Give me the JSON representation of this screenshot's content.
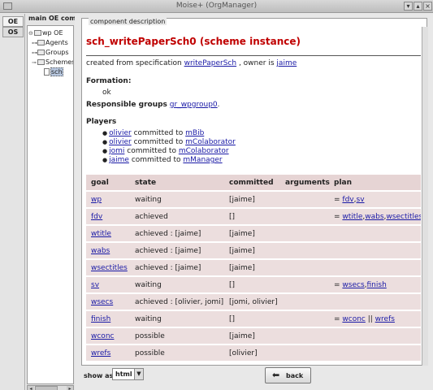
{
  "window": {
    "title": "Moise+ (OrgManager)"
  },
  "tabs": [
    {
      "label": "OE"
    },
    {
      "label": "OS"
    }
  ],
  "tree": {
    "header": "main OE com",
    "nodes": [
      {
        "label": "wp OE"
      },
      {
        "label": "Agents"
      },
      {
        "label": "Groups"
      },
      {
        "label": "Schemes"
      },
      {
        "label": "sch"
      }
    ]
  },
  "panel": {
    "legend": "component description"
  },
  "scheme": {
    "title": "sch_writePaperSch0 (scheme instance)",
    "created_prefix": "created from specification",
    "spec_link": "writePaperSch",
    "owner_text": ", owner is",
    "owner_link": "jaime"
  },
  "formation": {
    "label": "Formation:",
    "value": "ok"
  },
  "responsible": {
    "label": "Responsible groups",
    "link": "gr_wpgroup0",
    "trail": "."
  },
  "players": {
    "label": "Players",
    "items": [
      {
        "agent": "olivier",
        "text": "committed to",
        "mission": "mBib"
      },
      {
        "agent": "olivier",
        "text": "committed to",
        "mission": "mColaborator"
      },
      {
        "agent": "jomi",
        "text": "committed to",
        "mission": "mColaborator"
      },
      {
        "agent": "jaime",
        "text": "committed to",
        "mission": "mManager"
      }
    ]
  },
  "goals_table": {
    "headers": {
      "goal": "goal",
      "state": "state",
      "committed": "committed",
      "arguments": "arguments",
      "plan": "plan"
    },
    "rows": [
      {
        "goal": "wp",
        "state": "waiting",
        "committed": "[jaime]",
        "plan_op": "= ",
        "plan": [
          "fdv",
          "sv"
        ],
        "sep": ","
      },
      {
        "goal": "fdv",
        "state": "achieved",
        "committed": "[]",
        "plan_op": "= ",
        "plan": [
          "wtitle",
          "wabs",
          "wsectitles"
        ],
        "sep": ","
      },
      {
        "goal": "wtitle",
        "state": "achieved : [jaime]",
        "committed": "[jaime]",
        "plan_op": "",
        "plan": [],
        "sep": ""
      },
      {
        "goal": "wabs",
        "state": "achieved : [jaime]",
        "committed": "[jaime]",
        "plan_op": "",
        "plan": [],
        "sep": ""
      },
      {
        "goal": "wsectitles",
        "state": "achieved : [jaime]",
        "committed": "[jaime]",
        "plan_op": "",
        "plan": [],
        "sep": ""
      },
      {
        "goal": "sv",
        "state": "waiting",
        "committed": "[]",
        "plan_op": "= ",
        "plan": [
          "wsecs",
          "finish"
        ],
        "sep": ","
      },
      {
        "goal": "wsecs",
        "state": "achieved : [olivier, jomi]",
        "committed": "[jomi, olivier]",
        "plan_op": "",
        "plan": [],
        "sep": ""
      },
      {
        "goal": "finish",
        "state": "waiting",
        "committed": "[]",
        "plan_op": "= ",
        "plan": [
          "wconc",
          "wrefs"
        ],
        "sep": " || "
      },
      {
        "goal": "wconc",
        "state": "possible",
        "committed": "[jaime]",
        "plan_op": "",
        "plan": [],
        "sep": ""
      },
      {
        "goal": "wrefs",
        "state": "possible",
        "committed": "[olivier]",
        "plan_op": "",
        "plan": [],
        "sep": ""
      }
    ]
  },
  "footer": {
    "show_as_label": "show as",
    "show_as_value": "html",
    "back_label": "back"
  },
  "colors": {
    "scheme_title": "#c00000",
    "link": "#1a1aa6",
    "table_row": "#ecdede"
  },
  "icons": {
    "back": "back-arrow-icon",
    "folder": "folder-icon",
    "document": "document-icon"
  }
}
